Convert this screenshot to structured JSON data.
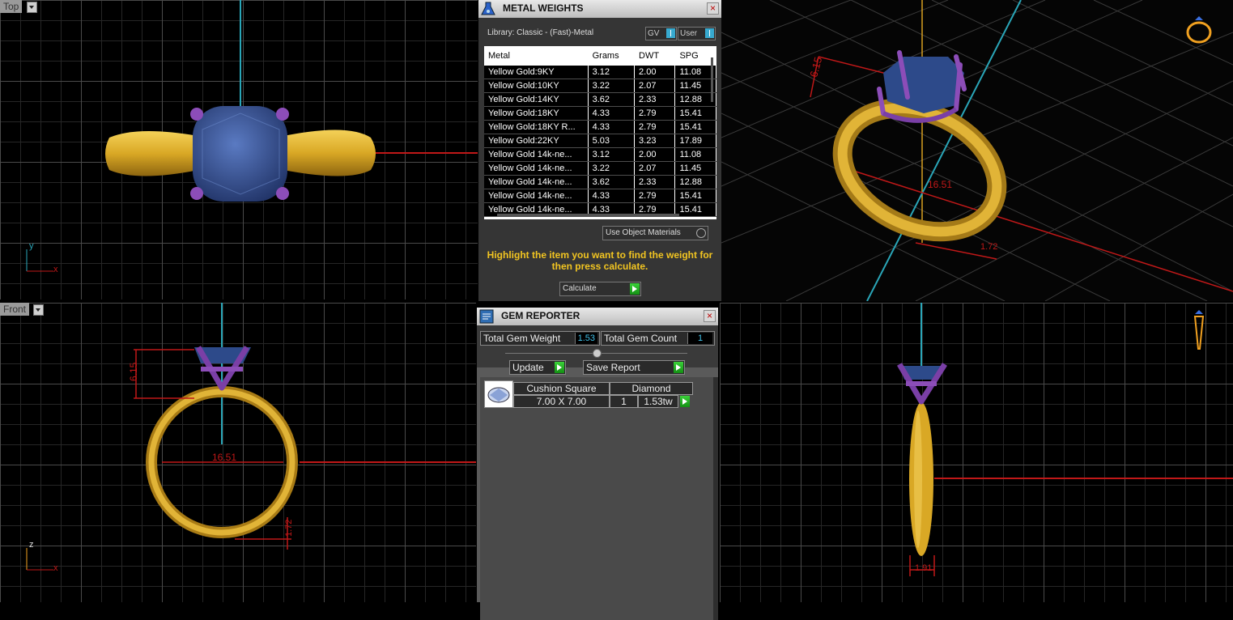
{
  "viewports": {
    "top_label": "Top",
    "front_label": "Front",
    "top_axes": {
      "y": "y",
      "x": "x"
    },
    "front_axes": {
      "y": "z",
      "x": "x"
    },
    "top_left_dim_a": "6.15",
    "front_dims": {
      "height": "6.15",
      "inner": "16.51",
      "band": "1.72"
    },
    "persp_dims": {
      "height": "6.15",
      "inner": "16.51",
      "band": "1.72"
    },
    "side_dims": {
      "width": "1.91"
    }
  },
  "metal_weights": {
    "title": "METAL WEIGHTS",
    "library": "Library: Classic - (Fast)-Metal",
    "toggle_gv": "GV",
    "toggle_user": "User",
    "columns": [
      "Metal",
      "Grams",
      "DWT",
      "SPG"
    ],
    "rows": [
      [
        "Yellow Gold:9KY",
        "3.12",
        "2.00",
        "11.08"
      ],
      [
        "Yellow Gold:10KY",
        "3.22",
        "2.07",
        "11.45"
      ],
      [
        "Yellow Gold:14KY",
        "3.62",
        "2.33",
        "12.88"
      ],
      [
        "Yellow Gold:18KY",
        "4.33",
        "2.79",
        "15.41"
      ],
      [
        "Yellow Gold:18KY R...",
        "4.33",
        "2.79",
        "15.41"
      ],
      [
        "Yellow Gold:22KY",
        "5.03",
        "3.23",
        "17.89"
      ],
      [
        "Yellow Gold 14k-ne...",
        "3.12",
        "2.00",
        "11.08"
      ],
      [
        "Yellow Gold 14k-ne...",
        "3.22",
        "2.07",
        "11.45"
      ],
      [
        "Yellow Gold 14k-ne...",
        "3.62",
        "2.33",
        "12.88"
      ],
      [
        "Yellow Gold 14k-ne...",
        "4.33",
        "2.79",
        "15.41"
      ],
      [
        "Yellow Gold 14k-ne...",
        "4.33",
        "2.79",
        "15.41"
      ]
    ],
    "use_object_materials": "Use Object Materials",
    "message": "Highlight the item you want to find the weight for then press calculate.",
    "calculate": "Calculate"
  },
  "gem_reporter": {
    "title": "GEM REPORTER",
    "total_gem_weight_label": "Total Gem Weight",
    "total_gem_weight": "1.53",
    "total_gem_count_label": "Total Gem Count",
    "total_gem_count": "1",
    "update": "Update",
    "save_report": "Save Report",
    "gem": {
      "shape": "Cushion Square",
      "type": "Diamond",
      "size": "7.00 X 7.00",
      "count": "1",
      "weight": "1.53tw"
    }
  },
  "colors": {
    "gold": "#d9a825",
    "gem": "#35528f",
    "prong": "#7a3fa6",
    "dimension": "#c01818",
    "axis": "#2aa6b8"
  }
}
